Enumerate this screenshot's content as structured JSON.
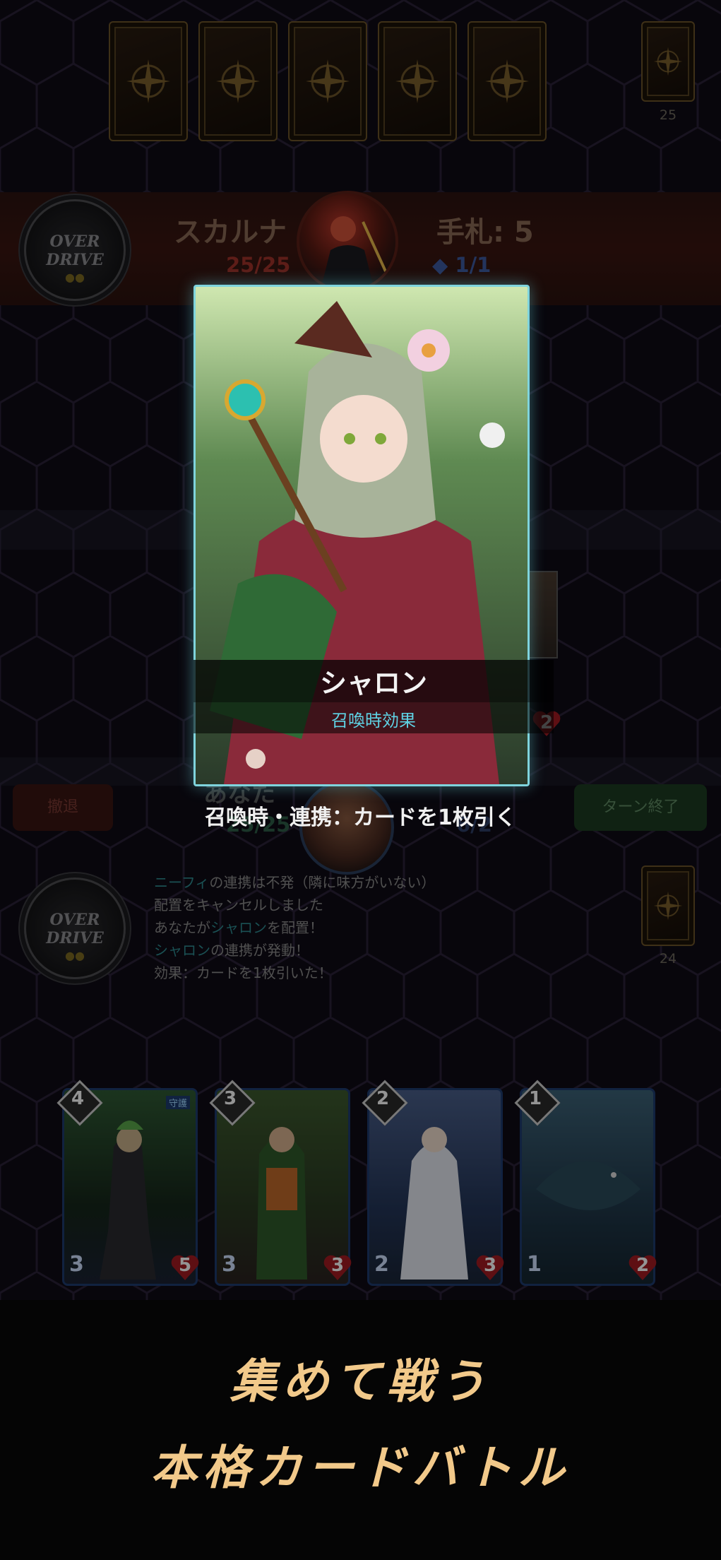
{
  "opponent": {
    "name": "スカルナ",
    "hp": "25/25",
    "hand_label": "手札: 5",
    "mana": "◆ 1/1",
    "deck_count": "25"
  },
  "overdrive_label": [
    "OVER",
    "DRIVE"
  ],
  "overdrive_dots": "●●",
  "player": {
    "name": "あなた",
    "hp": "25/25",
    "mana": "6/2",
    "deck_count": "24"
  },
  "buttons": {
    "retreat": "撤退",
    "end_turn": "ターン終了"
  },
  "focused_card": {
    "name": "シャロン",
    "subtitle": "召喚時効果",
    "effect": "召喚時・連携：カードを1枚引く",
    "hp": "2"
  },
  "log": [
    {
      "hl": "ニーフィ",
      "rest": "の連携は不発（隣に味方がいない）"
    },
    {
      "hl": "",
      "rest": "配置をキャンセルしました"
    },
    {
      "pre": "あなたが",
      "hl": "シャロン",
      "rest": "を配置！"
    },
    {
      "hl": "シャロン",
      "rest": "の連携が発動！"
    },
    {
      "hl": "",
      "rest": "効果：カードを1枚引いた！"
    }
  ],
  "hand": [
    {
      "cost": "4",
      "attack": "3",
      "hp": "5",
      "tag": "守護",
      "color": "#2f5a34"
    },
    {
      "cost": "3",
      "attack": "3",
      "hp": "3",
      "color": "#3d5a2e"
    },
    {
      "cost": "2",
      "attack": "2",
      "hp": "3",
      "color": "#4a5f8a"
    },
    {
      "cost": "1",
      "attack": "1",
      "hp": "2",
      "color": "#3c6277"
    }
  ],
  "taglines": [
    "集めて戦う",
    "本格カードバトル"
  ]
}
